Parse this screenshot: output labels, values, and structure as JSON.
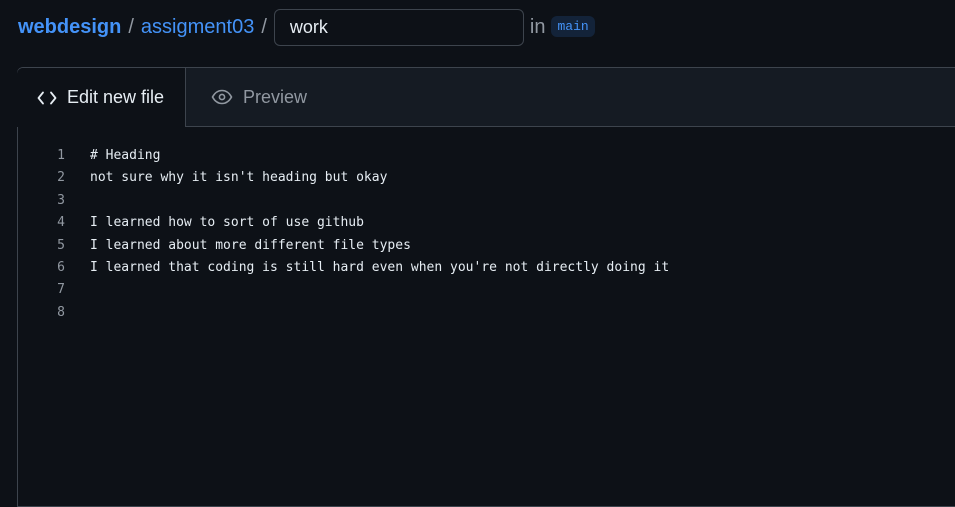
{
  "breadcrumb": {
    "owner": "webdesign",
    "separator": "/",
    "repo": "assigment03",
    "filename_value": "work",
    "in_label": "in",
    "branch": "main"
  },
  "tabs": {
    "edit": {
      "label": "Edit new file",
      "icon": "code-icon"
    },
    "preview": {
      "label": "Preview",
      "icon": "eye-icon"
    }
  },
  "editor": {
    "lines": [
      {
        "num": "1",
        "text": "# Heading"
      },
      {
        "num": "2",
        "text": "not sure why it isn't heading but okay"
      },
      {
        "num": "3",
        "text": ""
      },
      {
        "num": "4",
        "text": "I learned how to sort of use github"
      },
      {
        "num": "5",
        "text": "I learned about more different file types"
      },
      {
        "num": "6",
        "text": "I learned that coding is still hard even when you're not directly doing it"
      },
      {
        "num": "7",
        "text": ""
      },
      {
        "num": "8",
        "text": ""
      }
    ]
  },
  "colors": {
    "background": "#0d1117",
    "link": "#4493f8",
    "border": "#3d444d",
    "muted": "#9198a1",
    "text": "#e6edf3"
  }
}
